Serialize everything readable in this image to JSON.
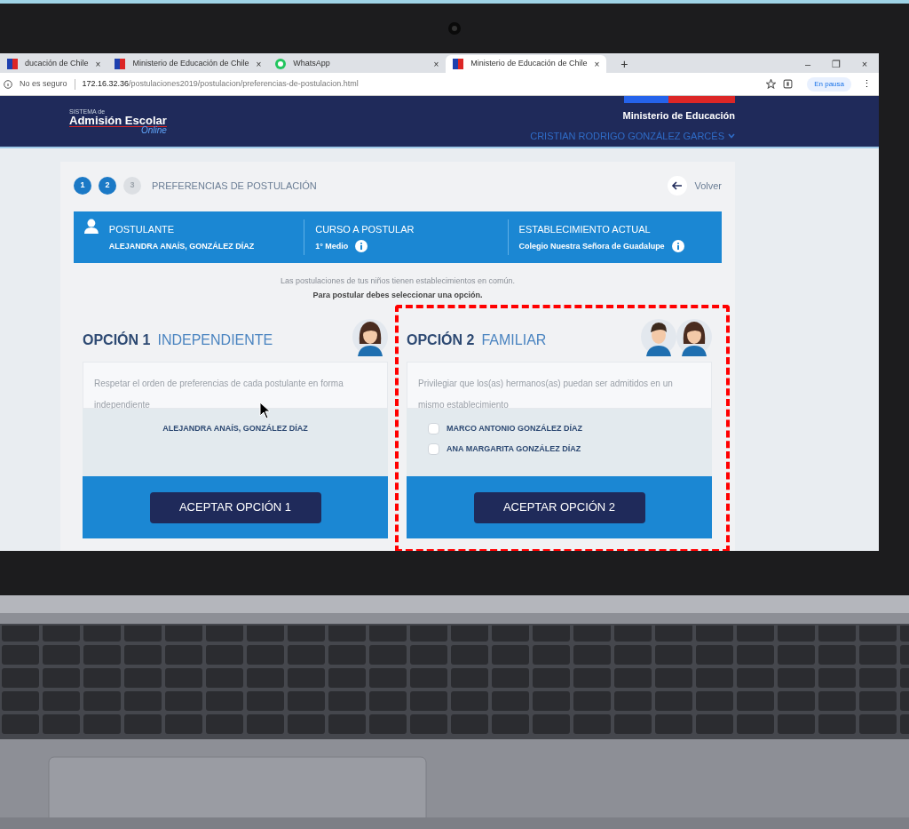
{
  "browser": {
    "tabs": [
      {
        "title": "ducación de Chile",
        "close": "×",
        "selected": false,
        "kind": "flag"
      },
      {
        "title": "Ministerio de Educación de Chile",
        "close": "×",
        "selected": false,
        "kind": "flag"
      },
      {
        "title": "WhatsApp",
        "close": "×",
        "selected": false,
        "kind": "chat"
      },
      {
        "title": "Ministerio de Educación de Chile",
        "close": "×",
        "selected": true,
        "kind": "flag"
      }
    ],
    "new_tab": "+",
    "window_controls": [
      "–",
      "❐",
      "×"
    ],
    "security": "No es seguro",
    "url_host": "172.16.32.36",
    "url_path": "/postulaciones2019/postulacion/preferencias-de-postulacion.html",
    "profile": "En pausa",
    "menu": "⋮"
  },
  "header": {
    "logo_small": "SISTEMA de",
    "logo_main": "Admisión Escolar",
    "logo_script": "Online",
    "ministry": "Ministerio de Educación",
    "user": "CRISTIAN RODRIGO GONZÁLEZ GARCÉS"
  },
  "steps": [
    {
      "label": "1",
      "disabled": false
    },
    {
      "label": "2",
      "disabled": false
    },
    {
      "label": "3",
      "disabled": true
    }
  ],
  "page_title": "PREFERENCIAS DE POSTULACIÓN",
  "back": "Volver",
  "info": [
    {
      "label": "POSTULANTE",
      "value": "ALEJANDRA ANAÍS, GONZÁLEZ DÍAZ",
      "info_icon": false
    },
    {
      "label": "CURSO A POSTULAR",
      "value": "1° Medio",
      "info_icon": true
    },
    {
      "label": "ESTABLECIMIENTO ACTUAL",
      "value": "Colegio Nuestra Señora de Guadalupe",
      "info_icon": true
    }
  ],
  "notice": "Las postulaciones de tus niños tienen establecimientos en común.",
  "notice_bold": "Para postular debes seleccionar una opción.",
  "options": [
    {
      "number": "OPCIÓN 1",
      "name": "INDEPENDIENTE",
      "avatars": [
        {
          "kind": "girl"
        }
      ],
      "description": "Respetar el orden de preferencias de cada postulante en forma independiente",
      "kind": "names",
      "students": [
        {
          "name": "ALEJANDRA ANAÍS, GONZÁLEZ DÍAZ"
        }
      ],
      "button": "ACEPTAR OPCIÓN 1",
      "highlighted": false
    },
    {
      "number": "OPCIÓN 2",
      "name": "FAMILIAR",
      "avatars": [
        {
          "kind": "boy"
        },
        {
          "kind": "girl"
        }
      ],
      "description": "Privilegiar que los(as) hermanos(as) puedan ser admitidos en un mismo establecimiento",
      "kind": "checklist",
      "students": [
        {
          "name": "MARCO ANTONIO GONZÁLEZ DÍAZ",
          "checked": false
        },
        {
          "name": "ANA MARGARITA GONZÁLEZ DÍAZ",
          "checked": false
        }
      ],
      "button": "ACEPTAR OPCIÓN 2",
      "highlighted": true
    }
  ]
}
